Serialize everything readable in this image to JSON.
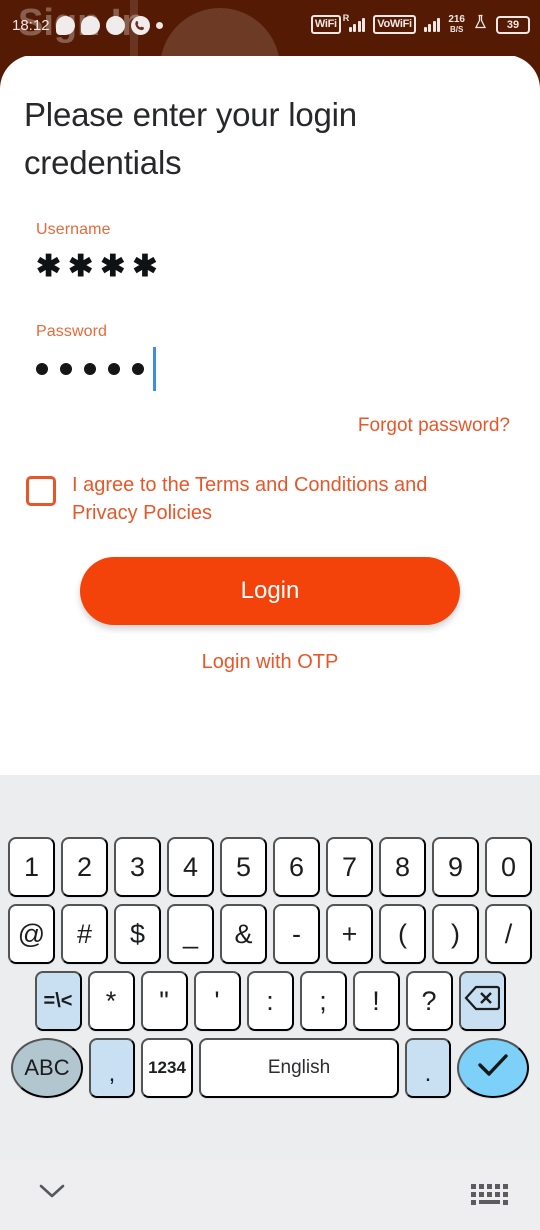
{
  "statusbar": {
    "time": "18:12",
    "notification_icons": [
      "message-bubble-icon",
      "message-bubble-icon",
      "whatsapp-icon",
      "phone-call-icon",
      "dot-icon"
    ],
    "wifi_badge": "WiFi",
    "roaming_letter": "R",
    "vowifi_badge": "VoWiFi",
    "network_speed_value": "216",
    "network_speed_unit": "B/S",
    "lab_icon": "flask-icon",
    "battery_level": "39",
    "background_color": "#551a03",
    "app_title_watermark": "Sign In"
  },
  "main": {
    "title": "Please enter your login credentials",
    "username": {
      "label": "Username",
      "value": "✱✱✱✱",
      "masked_char_count": 4
    },
    "password": {
      "label": "Password",
      "masked_char_count": 5,
      "cursor_visible": true,
      "cursor_color": "#3c8ede"
    },
    "forgot_password_label": "Forgot password?",
    "agree": {
      "label": "I agree to the Terms and Conditions and Privacy Policies",
      "checked": false
    },
    "login_button_label": "Login",
    "login_with_otp_label": "Login with OTP",
    "accent_color": "#f4430a",
    "link_color": "#e8572a"
  },
  "keyboard": {
    "background_color": "#ecedef",
    "rows": {
      "numbers": [
        "1",
        "2",
        "3",
        "4",
        "5",
        "6",
        "7",
        "8",
        "9",
        "0"
      ],
      "symbols": [
        "@",
        "#",
        "$",
        "_",
        "&",
        "-",
        "+",
        "(",
        ")",
        "/"
      ],
      "punctuation": [
        "*",
        "\"",
        "'",
        ":",
        ";",
        "!",
        "?"
      ]
    },
    "symbol_toggle_label": "=\\<",
    "backspace_label": "backspace-icon",
    "abc_key_label": "ABC",
    "comma_key_label": ",",
    "numeric_key_label": "1234",
    "space_key_label": "English",
    "period_key_label": ".",
    "enter_key_label": "checkmark-icon"
  },
  "navbar": {
    "hide_keyboard_label": "chevron-down-icon",
    "switch_keyboard_label": "keyboard-icon"
  }
}
